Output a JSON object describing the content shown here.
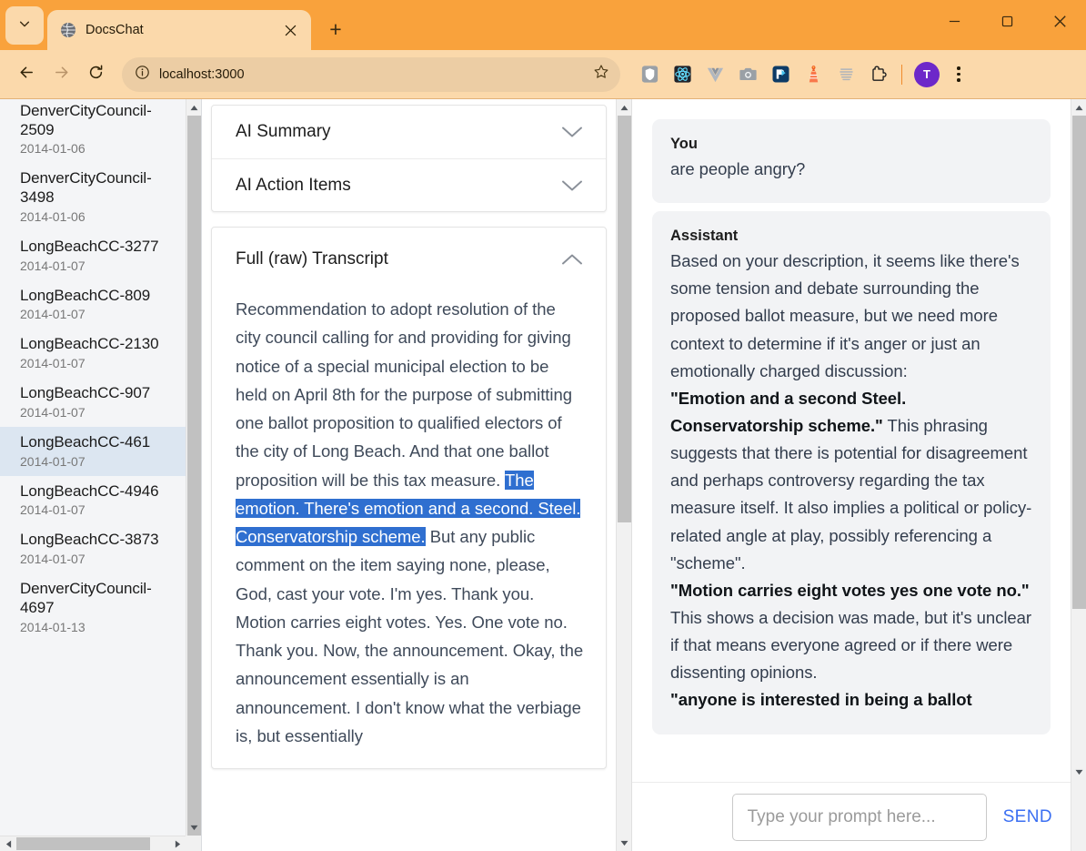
{
  "browser": {
    "tab": {
      "title": "DocsChat",
      "favicon_icon": "globe-icon",
      "close_icon": "close-icon"
    },
    "tablist_icon": "chevron-down-icon",
    "newtab_label": "+",
    "window": {
      "minimize": "minimize-icon",
      "maximize": "maximize-icon",
      "close": "close-icon"
    },
    "nav": {
      "back_icon": "arrow-left-icon",
      "forward_icon": "arrow-right-icon",
      "reload_icon": "reload-icon"
    },
    "omnibox": {
      "info_icon": "info-circle-icon",
      "url": "localhost:3000",
      "bookmark_icon": "star-icon"
    },
    "extensions": [
      {
        "name": "shield-extension-icon"
      },
      {
        "name": "react-devtools-icon"
      },
      {
        "name": "vue-devtools-icon"
      },
      {
        "name": "screenshot-camera-icon"
      },
      {
        "name": "pdf-reader-icon"
      },
      {
        "name": "lighthouse-icon"
      },
      {
        "name": "grammarly-icon"
      },
      {
        "name": "extensions-puzzle-icon"
      }
    ],
    "profile_initial": "T",
    "menu_icon": "kebab-menu-icon"
  },
  "sidebar": {
    "documents": [
      {
        "title": "DenverCityCouncil-2509",
        "date": "2014-01-06",
        "selected": false
      },
      {
        "title": "DenverCityCouncil-3498",
        "date": "2014-01-06",
        "selected": false
      },
      {
        "title": "LongBeachCC-3277",
        "date": "2014-01-07",
        "selected": false
      },
      {
        "title": "LongBeachCC-809",
        "date": "2014-01-07",
        "selected": false
      },
      {
        "title": "LongBeachCC-2130",
        "date": "2014-01-07",
        "selected": false
      },
      {
        "title": "LongBeachCC-907",
        "date": "2014-01-07",
        "selected": false
      },
      {
        "title": "LongBeachCC-461",
        "date": "2014-01-07",
        "selected": true
      },
      {
        "title": "LongBeachCC-4946",
        "date": "2014-01-07",
        "selected": false
      },
      {
        "title": "LongBeachCC-3873",
        "date": "2014-01-07",
        "selected": false
      },
      {
        "title": "DenverCityCouncil-4697",
        "date": "2014-01-13",
        "selected": false
      }
    ]
  },
  "middle": {
    "accordions": [
      {
        "title": "AI Summary",
        "expanded": false,
        "chevron": "chevron-down-icon"
      },
      {
        "title": "AI Action Items",
        "expanded": false,
        "chevron": "chevron-down-icon"
      }
    ],
    "transcript_panel": {
      "title": "Full (raw) Transcript",
      "expanded": true,
      "chevron": "chevron-up-icon",
      "text_before": "Recommendation to adopt resolution of the city council calling for and providing for giving notice of a special municipal election to be held on April 8th for the purpose of submitting one ballot proposition to qualified electors of the city of Long Beach. And that one ballot proposition will be this tax measure. ",
      "text_highlighted": "The emotion. There's emotion and a second. Steel. Conservatorship scheme.",
      "text_after": " But any public comment on the item saying none, please, God, cast your vote. I'm yes. Thank you. Motion carries eight votes. Yes. One vote no. Thank you. Now, the announcement. Okay, the announcement essentially is an announcement. I don't know what the verbiage is, but essentially"
    }
  },
  "chat": {
    "messages": [
      {
        "role": "You",
        "parts": [
          {
            "bold": false,
            "text": "are people angry?"
          }
        ]
      },
      {
        "role": "Assistant",
        "parts": [
          {
            "bold": false,
            "text": "Based on your description, it seems like there's some tension and debate surrounding the proposed ballot measure, but we need more context to determine if it's anger or just an emotionally charged discussion:\n"
          },
          {
            "bold": true,
            "text": "\"Emotion and a second Steel. Conservatorship scheme.\""
          },
          {
            "bold": false,
            "text": " This phrasing suggests that there is potential for disagreement and perhaps controversy regarding the tax measure itself. It also implies a political or policy-related angle at play, possibly referencing a \"scheme\".\n"
          },
          {
            "bold": true,
            "text": "\"Motion carries eight votes yes one vote no.\""
          },
          {
            "bold": false,
            "text": " This shows a decision was made, but it's unclear if that means everyone agreed or if there were dissenting opinions.\n"
          },
          {
            "bold": true,
            "text": "\"anyone is interested in being a ballot"
          }
        ]
      }
    ],
    "input": {
      "placeholder": "Type your prompt here...",
      "value": ""
    },
    "send_label": "SEND"
  },
  "colors": {
    "browser_accent": "#f9a23c",
    "toolbar_bg": "#fbd9ab",
    "selection_blue": "#2f6fd0",
    "send_blue": "#3b6ff2",
    "sidebar_selected": "#dce6f1"
  }
}
